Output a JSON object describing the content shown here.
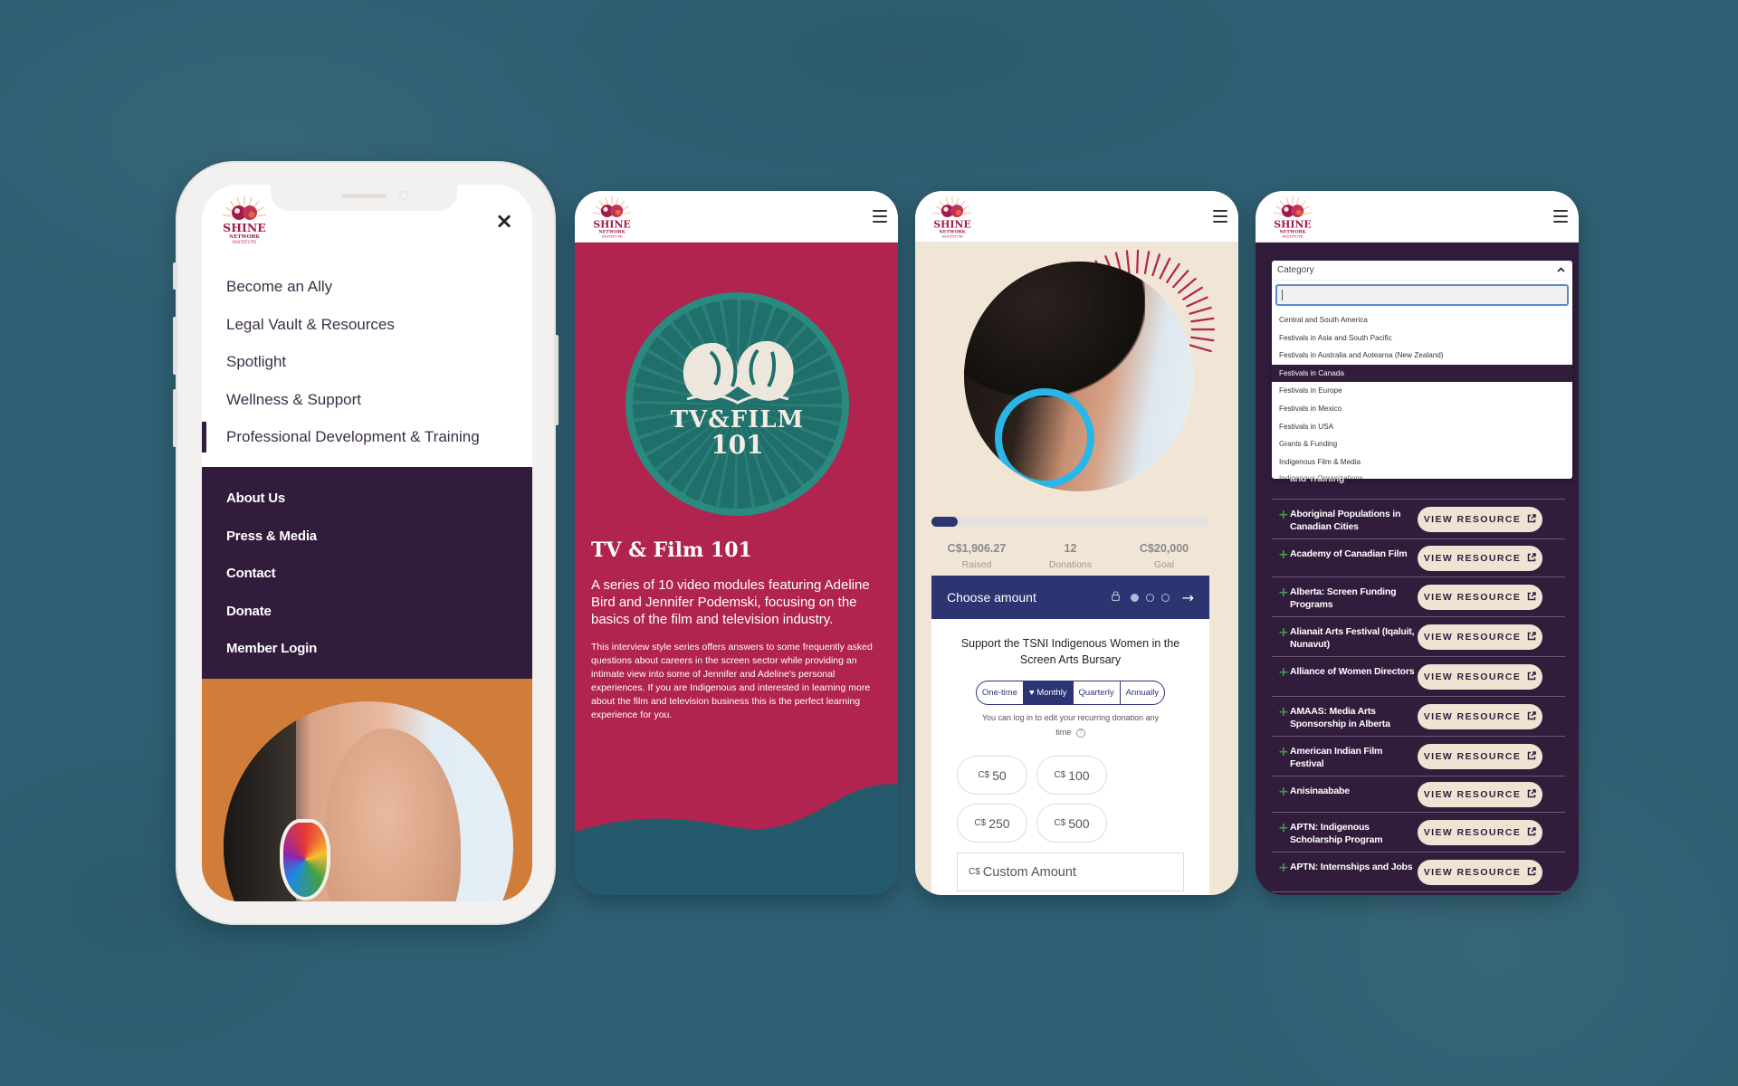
{
  "brand": {
    "logo_line1": "SHINE",
    "logo_line2": "NETWORK",
    "logo_line3": "INSTITUTE",
    "colors": {
      "background": "#2e5f72",
      "plum": "#311c3c",
      "crimson": "#b0244f",
      "teal": "#1f6f6a",
      "navy": "#2c3572",
      "cream": "#f1e5d6",
      "orange": "#d17d3a"
    }
  },
  "phone1": {
    "close_icon": "×",
    "primary_menu": [
      {
        "label": "Become an Ally"
      },
      {
        "label": "Legal Vault & Resources"
      },
      {
        "label": "Spotlight"
      },
      {
        "label": "Wellness & Support"
      },
      {
        "label": "Professional Development & Training",
        "active": true
      }
    ],
    "secondary_menu": [
      {
        "label": "About Us"
      },
      {
        "label": "Press & Media"
      },
      {
        "label": "Contact"
      },
      {
        "label": "Donate"
      },
      {
        "label": "Member Login"
      }
    ]
  },
  "phone2": {
    "badge_line1": "TV&FILM",
    "badge_line2": "101",
    "title": "TV & Film 101",
    "lead": "A series of 10 video modules featuring Adeline Bird and Jennifer Podemski, focusing on the basics of the film and television industry.",
    "body": "This interview style series offers answers to some frequently asked questions about careers in the screen sector while providing an intimate view into some of Jennifer and Adeline's personal experiences. If you are Indigenous and interested in learning more about the film and television business this is the perfect learning experience for you."
  },
  "phone3": {
    "progress_fraction": 0.0953,
    "stats": [
      {
        "value": "C$1,906.27",
        "label": "Raised"
      },
      {
        "value": "12",
        "label": "Donations"
      },
      {
        "value": "C$20,000",
        "label": "Goal"
      }
    ],
    "form_header": "Choose amount",
    "lock_icon": "🔒",
    "arrow_icon": "→",
    "step_current": 1,
    "step_total": 3,
    "campaign": "Support the TSNI Indigenous Women in the Screen Arts Bursary",
    "frequencies": [
      {
        "label": "One-time"
      },
      {
        "label": "♥ Monthly",
        "selected": true
      },
      {
        "label": "Quarterly"
      },
      {
        "label": "Annually"
      }
    ],
    "recurring_note": "You can log in to edit your recurring donation any time",
    "help_icon": "?",
    "currency": "C$",
    "amounts": [
      "50",
      "100",
      "250",
      "500"
    ],
    "custom_placeholder": "Custom Amount"
  },
  "phone4": {
    "dropdown_label": "Category",
    "chevron_up": "^",
    "search_value": "",
    "options": [
      {
        "label": "Central and South America"
      },
      {
        "label": "Festivals in Asia and South Pacific"
      },
      {
        "label": "Festivals in Australia and Aotearoa (New Zealand)"
      },
      {
        "label": "Festivals in Canada",
        "highlighted": true
      },
      {
        "label": "Festivals in Europe"
      },
      {
        "label": "Festivals in Mexico"
      },
      {
        "label": "Festivals in USA"
      },
      {
        "label": "Grants & Funding"
      },
      {
        "label": "Indigenous Film & Media"
      },
      {
        "label": "Indigenous Organizations"
      }
    ],
    "button_label": "VIEW RESOURCE",
    "ext_icon": "↗",
    "resources": [
      {
        "name": "and Training"
      },
      {
        "name": "Aboriginal Populations in Canadian Cities"
      },
      {
        "name": "Academy of Canadian Film"
      },
      {
        "name": "Alberta: Screen Funding Programs"
      },
      {
        "name": "Alianait Arts Festival (Iqaluit, Nunavut)"
      },
      {
        "name": "Alliance of Women Directors"
      },
      {
        "name": "AMAAS: Media Arts Sponsorship in Alberta"
      },
      {
        "name": "American Indian Film Festival"
      },
      {
        "name": "Anisinaababe"
      },
      {
        "name": "APTN: Indigenous Scholarship Program"
      },
      {
        "name": "APTN: Internships and Jobs"
      }
    ]
  }
}
